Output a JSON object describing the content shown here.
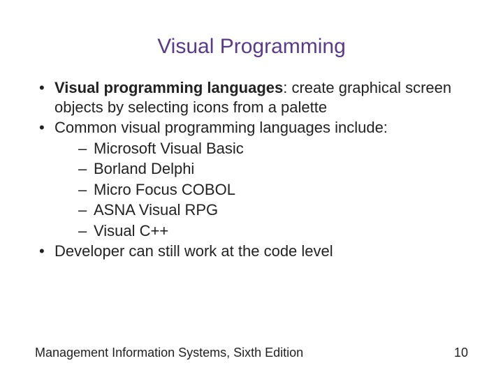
{
  "title": "Visual Programming",
  "bullets": {
    "b1": {
      "bold": "Visual programming languages",
      "rest": ": create graphical screen objects by selecting icons from a palette"
    },
    "b2": "Common visual programming languages include:",
    "sub": {
      "s1": "Microsoft Visual Basic",
      "s2": "Borland Delphi",
      "s3": "Micro Focus COBOL",
      "s4": "ASNA Visual RPG",
      "s5": "Visual C++"
    },
    "b3": "Developer can still work at the code level"
  },
  "footer": {
    "left": "Management Information Systems, Sixth Edition",
    "right": "10"
  }
}
